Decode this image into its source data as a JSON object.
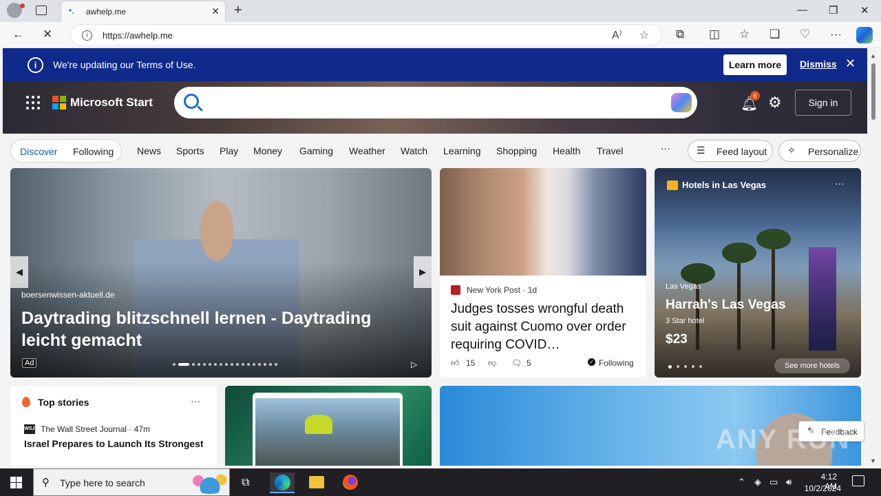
{
  "browser": {
    "tab_title": "awhelp.me",
    "url": "https://awhelp.me",
    "window_controls": {
      "minimize": "—",
      "restore": "❐",
      "close": "✕"
    }
  },
  "banner": {
    "text": "We're updating our Terms of Use.",
    "learn_more": "Learn more",
    "dismiss": "Dismiss"
  },
  "header": {
    "brand": "Microsoft Start",
    "notification_count": "6",
    "sign_in": "Sign in"
  },
  "nav": {
    "discover": "Discover",
    "following": "Following",
    "items": [
      "News",
      "Sports",
      "Play",
      "Money",
      "Gaming",
      "Weather",
      "Watch",
      "Learning",
      "Shopping",
      "Health",
      "Travel"
    ],
    "more": "···",
    "feed_layout": "Feed layout",
    "personalize": "Personalize"
  },
  "carousel": {
    "source": "boersenwissen-aktuell.de",
    "title": "Daytrading blitzschnell lernen - Daytrading leicht gemacht",
    "ad_label": "Ad"
  },
  "news_card": {
    "publisher": "New York Post",
    "age": "1d",
    "title": "Judges tosses wrongful death suit against Cuomo over order requiring COVID…",
    "likes": "15",
    "comments": "5",
    "following": "Following"
  },
  "hotel_card": {
    "header": "Hotels in Las Vegas",
    "city": "Las Vegas",
    "name": "Harrah's Las Vegas",
    "stars": "3 Star hotel",
    "price": "$23",
    "see_more": "See more hotels"
  },
  "top_stories": {
    "title": "Top stories",
    "wsj_label": "WSJ",
    "source": "The Wall Street Journal · 47m",
    "headline": "Israel Prepares to Launch Its Strongest Strike Yet"
  },
  "feedback": "Feedback",
  "watermark": "ANY RUN",
  "taskbar": {
    "search_placeholder": "Type here to search",
    "time": "4:12 AM",
    "date": "10/2/2024"
  },
  "colors": {
    "banner_bg": "#0f2a8a",
    "accent": "#0b5ec9"
  }
}
